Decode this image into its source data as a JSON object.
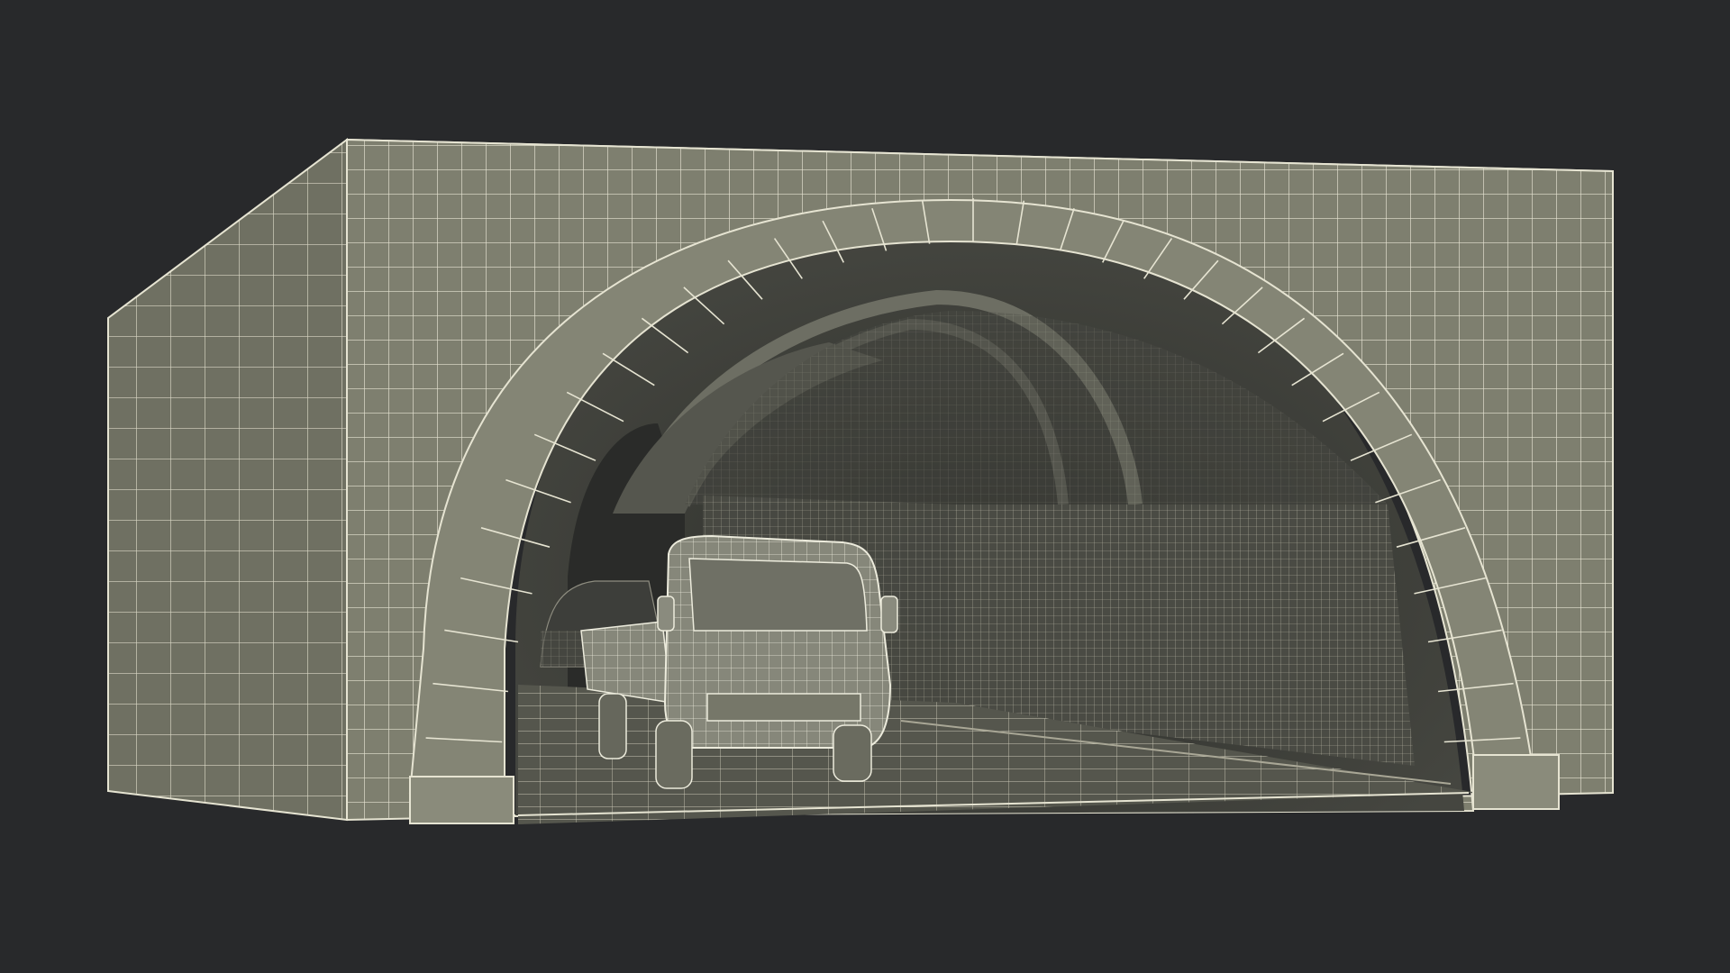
{
  "scene": {
    "subject": "wireframe-tunnel-render",
    "colors": {
      "background": "#28292b",
      "surface": "#7e7f6f",
      "surface_dark": "#5f6055",
      "interior": "#3a3b36",
      "interior_deep": "#2b2c29",
      "wire": "#e6e4d2"
    }
  }
}
